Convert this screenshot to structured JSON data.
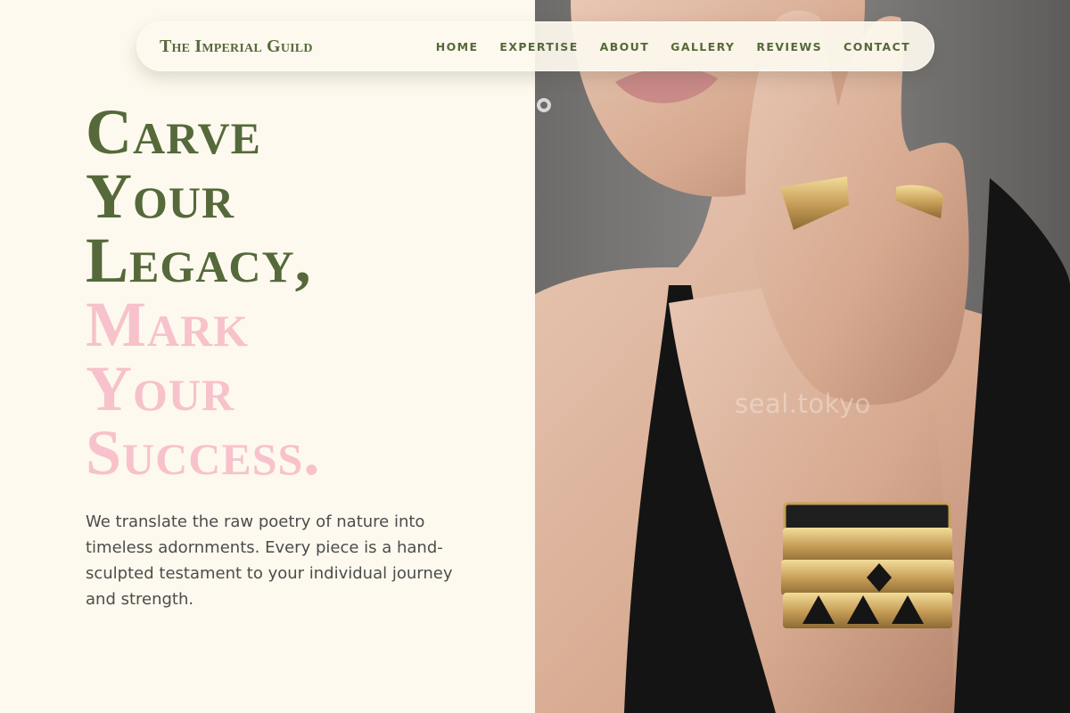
{
  "nav": {
    "brand": "The Imperial Guild",
    "items": [
      "HOME",
      "EXPERTISE",
      "ABOUT",
      "GALLERY",
      "REVIEWS",
      "CONTACT"
    ]
  },
  "hero": {
    "title_lines": [
      "Carve",
      "Your",
      "Legacy,"
    ],
    "accent_lines": [
      "Mark",
      "Your",
      "Success."
    ],
    "body": "We translate the raw poetry of nature into timeless adornments. Every piece is a hand-sculpted testament to your individual journey and strength."
  },
  "photo": {
    "watermark": "seal.tokyo"
  },
  "colors": {
    "background": "#fdf9ee",
    "primary_green": "#55693a",
    "accent_pink": "#f7c2cc",
    "body_text": "#4c4c4c"
  }
}
